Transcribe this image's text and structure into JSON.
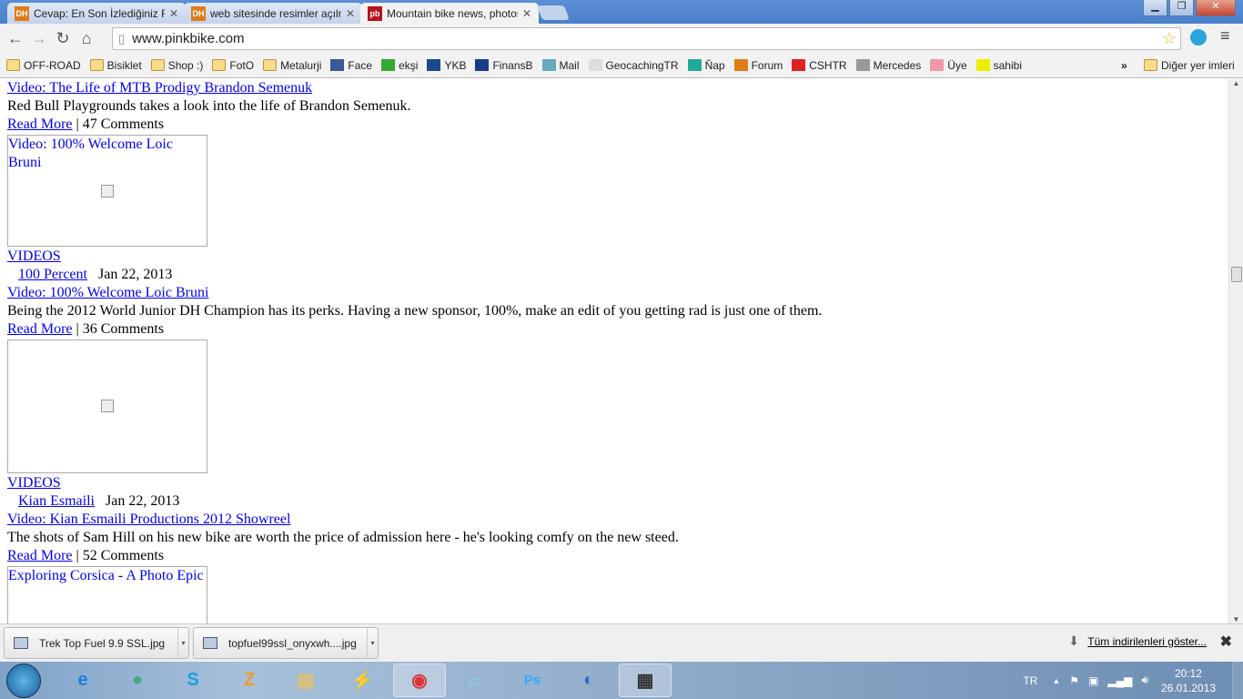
{
  "browser": {
    "tabs": [
      {
        "title": "Cevap: En Son İzlediğiniz Film",
        "favicon": "DH",
        "active": false
      },
      {
        "title": "web sitesinde resimler açılmıyor",
        "favicon": "DH",
        "active": false
      },
      {
        "title": "Mountain bike news, photos",
        "favicon": "pb",
        "active": true
      }
    ],
    "url": "www.pinkbike.com",
    "bookmarks": [
      {
        "label": "OFF-ROAD",
        "icon": "folder-icon"
      },
      {
        "label": "Bisiklet",
        "icon": "folder-icon"
      },
      {
        "label": "Shop :)",
        "icon": "folder-icon"
      },
      {
        "label": "FotO",
        "icon": "folder-icon"
      },
      {
        "label": "Metalurji",
        "icon": "folder-icon"
      },
      {
        "label": "Face",
        "icon": "facebook-icon"
      },
      {
        "label": "ekşi",
        "icon": "drop-icon"
      },
      {
        "label": "YKB",
        "icon": "ykb-icon"
      },
      {
        "label": "FinansB",
        "icon": "finansbank-icon"
      },
      {
        "label": "Mail",
        "icon": "mail-icon"
      },
      {
        "label": "GeocachingTR",
        "icon": "page-icon"
      },
      {
        "label": "Ňap",
        "icon": "nap-icon"
      },
      {
        "label": "Forum",
        "icon": "dh-icon"
      },
      {
        "label": "CSHTR",
        "icon": "flag-icon"
      },
      {
        "label": "Mercedes",
        "icon": "mercedes-icon"
      },
      {
        "label": "Üye",
        "icon": "user-icon"
      },
      {
        "label": "sahibi",
        "icon": "s-icon"
      }
    ],
    "more_bookmarks": "»",
    "other_bookmarks": "Diğer yer imleri"
  },
  "page": {
    "top": {
      "title": "Video: The Life of MTB Prodigy Brandon Semenuk",
      "desc": "Red Bull Playgrounds takes a look into the life of Brandon Semenuk.",
      "read_more": "Read More",
      "comments": "47 Comments"
    },
    "items": [
      {
        "img_caption": "Video: 100% Welcome Loic Bruni",
        "category": "VIDEOS",
        "author": "100 Percent",
        "date": "Jan 22, 2013",
        "title": "Video: 100% Welcome Loic Bruni",
        "desc": "Being the 2012 World Junior DH Champion has its perks. Having a new sponsor, 100%, make an edit of you getting rad is just one of them.",
        "read_more": "Read More",
        "comments": "36 Comments"
      },
      {
        "img_caption": "",
        "category": "VIDEOS",
        "author": "Kian Esmaili",
        "date": "Jan 22, 2013",
        "title": "Video: Kian Esmaili Productions 2012 Showreel",
        "desc": "The shots of Sam Hill on his new bike are worth the price of admission here - he's looking comfy on the new steed.",
        "read_more": "Read More",
        "comments": "52 Comments"
      }
    ],
    "last_img_caption": "Exploring Corsica - A Photo Epic"
  },
  "downloads": {
    "items": [
      "Trek Top Fuel 9.9 SSL.jpg",
      "topfuel99ssl_onyxwh....jpg"
    ],
    "show_all": "Tüm indirilenleri göster..."
  },
  "taskbar": {
    "lang": "TR",
    "time": "20:12",
    "date": "26.01.2013"
  }
}
